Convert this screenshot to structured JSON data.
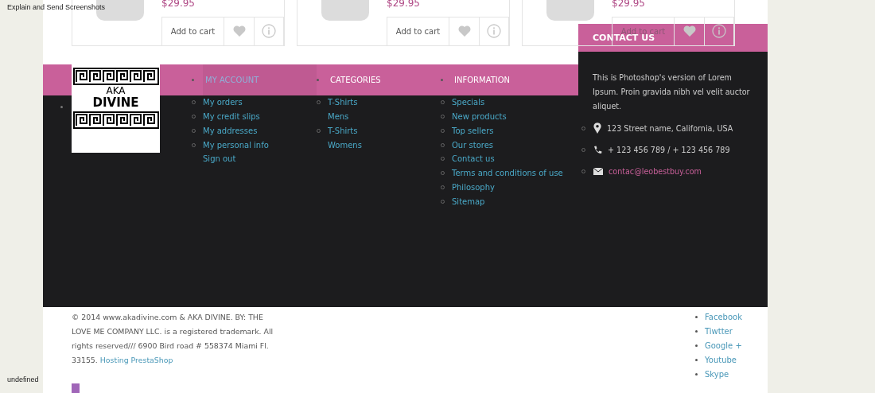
{
  "overlay_texts": {
    "top": "Explain and Send Screenshots",
    "bottom": "undefined"
  },
  "products": [
    {
      "price": "$29.95",
      "cart": "Add to cart"
    },
    {
      "price": "$29.95",
      "cart": "Add to cart"
    },
    {
      "price": "$29.95",
      "cart": "Add to cart"
    }
  ],
  "logo": {
    "top": "AKA",
    "bottom": "DIVINE"
  },
  "footer_columns": [
    {
      "title": "MY ACCOUNT",
      "selected": true,
      "items": [
        {
          "label": "My orders"
        },
        {
          "label": "My credit slips"
        },
        {
          "label": "My addresses"
        },
        {
          "label": "My personal info"
        },
        {
          "label": "Sign out",
          "bullet": false
        }
      ]
    },
    {
      "title": "CATEGORIES",
      "selected": false,
      "items": [
        {
          "label": "T-Shirts",
          "children": [
            {
              "label": "Mens"
            }
          ]
        },
        {
          "label": "T-Shirts",
          "children": [
            {
              "label": "Womens"
            }
          ]
        }
      ]
    },
    {
      "title": "INFORMATION",
      "selected": false,
      "items": [
        {
          "label": "Specials"
        },
        {
          "label": "New products"
        },
        {
          "label": "Top sellers"
        },
        {
          "label": "Our stores"
        },
        {
          "label": "Contact us"
        },
        {
          "label": "Terms and conditions of use"
        },
        {
          "label": "Philosophy"
        },
        {
          "label": "Sitemap"
        }
      ]
    }
  ],
  "contact": {
    "title": "CONTACT US",
    "text": "This is Photoshop's version of Lorem Ipsum. Proin gravida nibh vel velit auctor aliquet.",
    "items": [
      {
        "kind": "address",
        "text": "123 Street name, California, USA"
      },
      {
        "kind": "phone",
        "text": "+ 123 456 789 / + 123 456 789"
      },
      {
        "kind": "email",
        "text": "contac@leobestbuy.com"
      }
    ]
  },
  "copyright": {
    "text": "© 2014 www.akadivine.com & AKA DIVINE. BY: THE LOVE ME COMPANY LLC. is a registered trademark. All rights reserved/// 6900 Bird road # 558374 Miami Fl. 33155.",
    "link": "Hosting PrestaShop"
  },
  "social": [
    "Facebook",
    "Tiwtter",
    "Google +",
    "Youtube",
    "Skype"
  ]
}
